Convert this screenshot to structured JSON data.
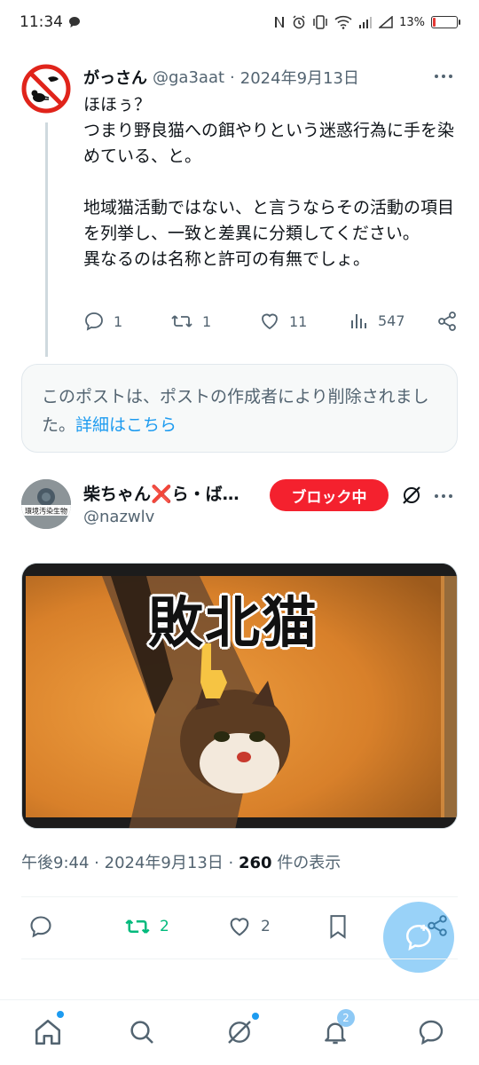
{
  "status_bar": {
    "time": "11:34",
    "battery_percent": "13%",
    "battery_level": 0.13,
    "icons": [
      "message-icon",
      "nfc-icon",
      "alarm-icon",
      "vibrate-icon",
      "wifi-icon",
      "signal-icon",
      "signal-icon",
      "battery-icon"
    ]
  },
  "tweet1": {
    "author_name": "がっさん",
    "author_handle": "@ga3aat",
    "separator": "·",
    "date": "2024年9月13日",
    "body": "ほほぅ？\nつまり野良猫への餌やりという迷惑行為に手を染めている、と。\n\n地域猫活動ではない、と言うならその活動の項目を列挙し、一致と差異に分類してください。\n異なるのは名称と許可の有無でしょ。",
    "replies": "1",
    "reposts": "1",
    "likes": "11",
    "views": "547"
  },
  "deleted_notice": {
    "text": "このポストは、ポストの作成者により削除されました。",
    "link": "詳細はこちら"
  },
  "tweet2": {
    "author_name": "柴ちゃん❌ら・ば…",
    "author_handle": "@nazwlv",
    "block_label": "ブロック中",
    "avatar_caption": "環境汚染生物",
    "media_caption": "敗北猫",
    "time": "午後9:44",
    "separator": "·",
    "date": "2024年9月13日",
    "separator2": "·",
    "views_count": "260",
    "views_label": "件の表示",
    "reposts": "2",
    "likes": "2"
  },
  "bottom_nav": {
    "notifications_badge": "2",
    "items": [
      "home-icon",
      "search-icon",
      "grok-icon",
      "notifications-icon",
      "messages-icon"
    ]
  },
  "colors": {
    "accent": "#1d9bf0",
    "block": "#f4212e",
    "repost_active": "#00ba7c",
    "text_secondary": "#536471"
  }
}
